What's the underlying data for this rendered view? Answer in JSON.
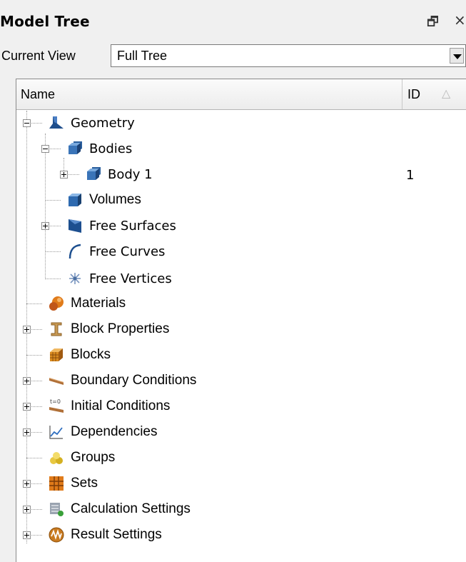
{
  "panel": {
    "title": "Model Tree",
    "float_glyph": "🗗",
    "close_glyph": "×"
  },
  "view": {
    "label": "Current View",
    "selected": "Full Tree"
  },
  "columns": {
    "name": "Name",
    "id": "ID",
    "sort_glyph": "△"
  },
  "tree": [
    {
      "label": "Geometry",
      "icon": "geometry-icon",
      "expander": "minus",
      "level": 0
    },
    {
      "label": "Bodies",
      "icon": "bodies-icon",
      "expander": "minus",
      "level": 1
    },
    {
      "label": "Body 1",
      "icon": "body-icon",
      "expander": "plus",
      "level": 2,
      "id": "1"
    },
    {
      "label": "Volumes",
      "icon": "volume-icon",
      "expander": "none",
      "level": 1
    },
    {
      "label": "Free Surfaces",
      "icon": "surface-icon",
      "expander": "plus",
      "level": 1
    },
    {
      "label": "Free Curves",
      "icon": "curve-icon",
      "expander": "none",
      "level": 1
    },
    {
      "label": "Free Vertices",
      "icon": "vertex-icon",
      "expander": "none",
      "level": 1
    },
    {
      "label": "Materials",
      "icon": "materials-icon",
      "expander": "none",
      "level": 0
    },
    {
      "label": "Block Properties",
      "icon": "block-properties-icon",
      "expander": "plus",
      "level": 0
    },
    {
      "label": "Blocks",
      "icon": "blocks-icon",
      "expander": "none",
      "level": 0
    },
    {
      "label": "Boundary Conditions",
      "icon": "boundary-conditions-icon",
      "expander": "plus",
      "level": 0
    },
    {
      "label": "Initial Conditions",
      "icon": "initial-conditions-icon",
      "expander": "plus",
      "level": 0
    },
    {
      "label": "Dependencies",
      "icon": "dependencies-icon",
      "expander": "plus",
      "level": 0
    },
    {
      "label": "Groups",
      "icon": "groups-icon",
      "expander": "none",
      "level": 0
    },
    {
      "label": "Sets",
      "icon": "sets-icon",
      "expander": "plus",
      "level": 0
    },
    {
      "label": "Calculation Settings",
      "icon": "calculation-settings-icon",
      "expander": "plus",
      "level": 0
    },
    {
      "label": "Result Settings",
      "icon": "result-settings-icon",
      "expander": "plus",
      "level": 0
    }
  ],
  "initial_conditions_icon_text": "t=0",
  "colors": {
    "geometry_blue": "#1f4e8c",
    "materials_orange": "#e07b1a",
    "brown": "#a0602a"
  }
}
